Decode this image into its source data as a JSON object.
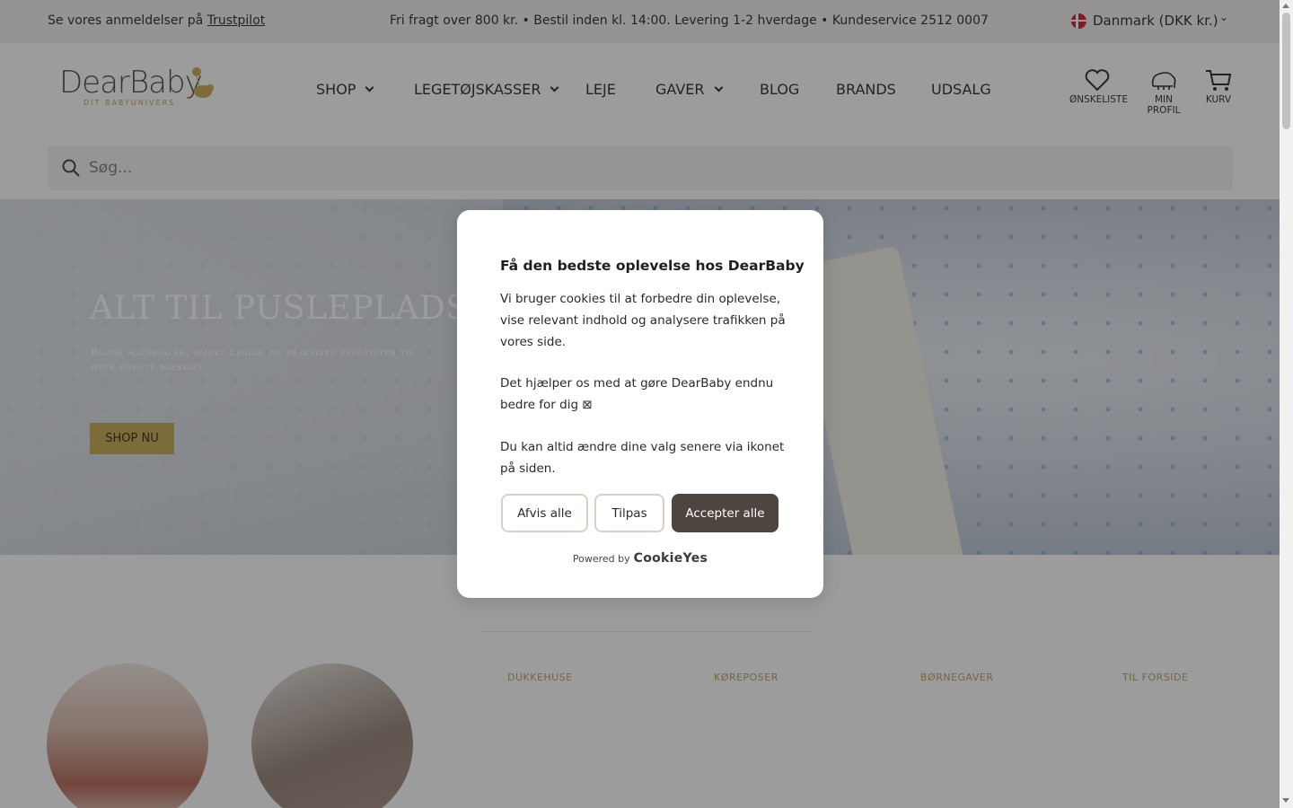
{
  "topbar": {
    "reviews_prefix": "Se vores anmeldelser på",
    "reviews_link": "Trustpilot",
    "info": "Fri fragt over 800 kr. • Bestil inden kl. 14:00. Levering 1-2 hverdage • Kundeservice 2512 0007",
    "country": "Danmark (DKK kr.)"
  },
  "logo": {
    "name": "DearBaby",
    "tagline": "DIT BABYUNIVERS"
  },
  "nav": [
    {
      "label": "SHOP",
      "dropdown": true
    },
    {
      "label": "LEGETØJSKASSER",
      "dropdown": true
    },
    {
      "label": "LEJE",
      "dropdown": false
    },
    {
      "label": "GAVER",
      "dropdown": true
    },
    {
      "label": "BLOG",
      "dropdown": false
    },
    {
      "label": "BRANDS",
      "dropdown": false
    },
    {
      "label": "UDSALG",
      "dropdown": false
    }
  ],
  "header_icons": {
    "wishlist": "ØNSKELISTE",
    "profile": "MIN PROFIL",
    "cart": "KURV"
  },
  "search": {
    "placeholder": "Søg..."
  },
  "hero": {
    "title": "ALT TIL PUSLEPLADSEN",
    "subtitle": "Bløde materialer, smukt design og praktiske favoritter til hver eneste bleskift",
    "button": "SHOP NU"
  },
  "categories": [
    "DUKKEHUSE",
    "KØREPOSER",
    "BØRNEGAVER",
    "TIL FORSIDE"
  ],
  "cookie": {
    "title": "Få den bedste oplevelse hos DearBaby",
    "p1": "Vi bruger cookies til at forbedre din oplevelse, vise relevant indhold og analysere trafikken på vores side.",
    "p2": "Det hjælper os med at gøre DearBaby endnu bedre for dig ⊠",
    "p3": "Du kan altid ændre dine valg senere via ikonet på siden.",
    "reject": "Afvis alle",
    "customize": "Tilpas",
    "accept": "Accepter alle",
    "powered_by": "Powered by",
    "powered_brand": "CookieYes"
  },
  "colors": {
    "accent": "#c5a74a",
    "accept_button": "#4e4540",
    "topbar": "#f3f1ec"
  }
}
